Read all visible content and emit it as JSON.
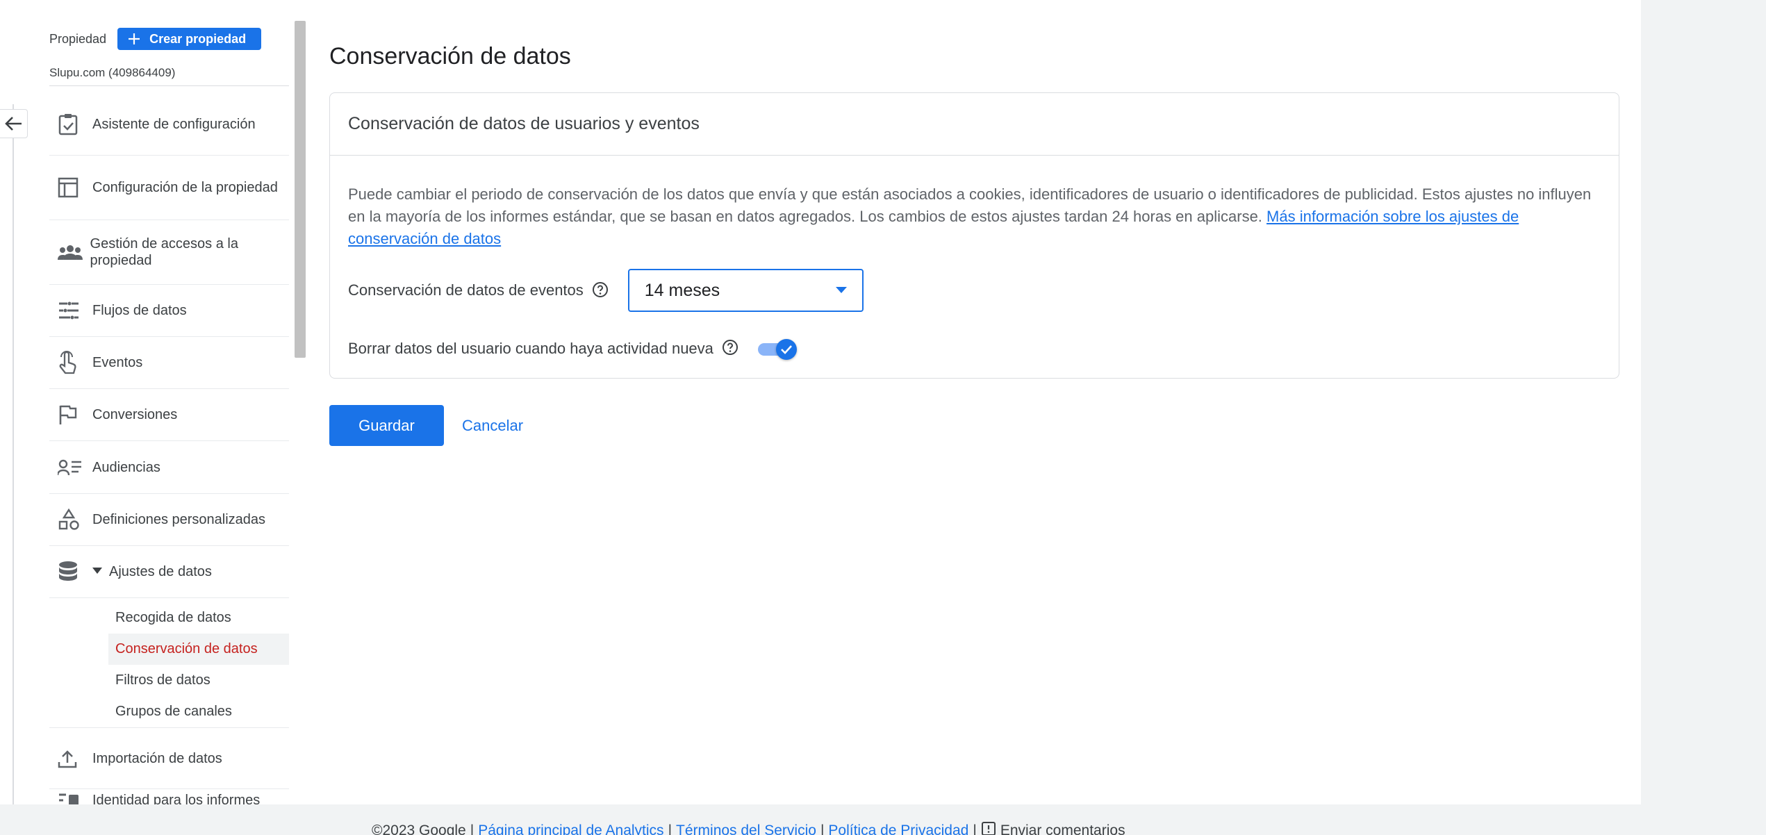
{
  "property": {
    "label": "Propiedad",
    "create_button": "Crear propiedad",
    "name": "Slupu.com (409864409)"
  },
  "nav": {
    "items": [
      {
        "label": "Asistente de configuración",
        "icon": "clipboard-check-icon"
      },
      {
        "label": "Configuración de la propiedad",
        "icon": "layout-icon"
      },
      {
        "label": "Gestión de accesos a la propiedad",
        "icon": "people-icon"
      },
      {
        "label": "Flujos de datos",
        "icon": "streams-icon"
      },
      {
        "label": "Eventos",
        "icon": "touch-icon"
      },
      {
        "label": "Conversiones",
        "icon": "flag-icon"
      },
      {
        "label": "Audiencias",
        "icon": "audience-icon"
      },
      {
        "label": "Definiciones personalizadas",
        "icon": "shapes-icon"
      },
      {
        "label": "Ajustes de datos",
        "icon": "database-icon"
      }
    ],
    "sub_items": [
      {
        "label": "Recogida de datos"
      },
      {
        "label": "Conservación de datos"
      },
      {
        "label": "Filtros de datos"
      },
      {
        "label": "Grupos de canales"
      }
    ],
    "after": [
      {
        "label": "Importación de datos",
        "icon": "upload-icon"
      },
      {
        "label": "Identidad para los informes",
        "icon": "identity-icon"
      }
    ]
  },
  "main": {
    "title": "Conservación de datos",
    "card_title": "Conservación de datos de usuarios y eventos",
    "description": "Puede cambiar el periodo de conservación de los datos que envía y que están asociados a cookies, identificadores de usuario o identificadores de publicidad. Estos ajustes no influyen en la mayoría de los informes estándar, que se basan en datos agregados. Los cambios de estos ajustes tardan 24 horas en aplicarse.",
    "learn_more": "Más información sobre los ajustes de conservación de datos",
    "event_retention_label": "Conservación de datos de eventos",
    "event_retention_value": "14 meses",
    "reset_label": "Borrar datos del usuario cuando haya actividad nueva",
    "reset_enabled": true,
    "save": "Guardar",
    "cancel": "Cancelar"
  },
  "footer": {
    "copyright": "©2023 Google",
    "sep": "|",
    "home": "Página principal de Analytics",
    "terms": "Términos del Servicio",
    "privacy": "Política de Privacidad",
    "feedback": "Enviar comentarios"
  },
  "colors": {
    "accent": "#1a73e8",
    "active_nav": "#c5221f",
    "progress": "#f9ab00"
  }
}
